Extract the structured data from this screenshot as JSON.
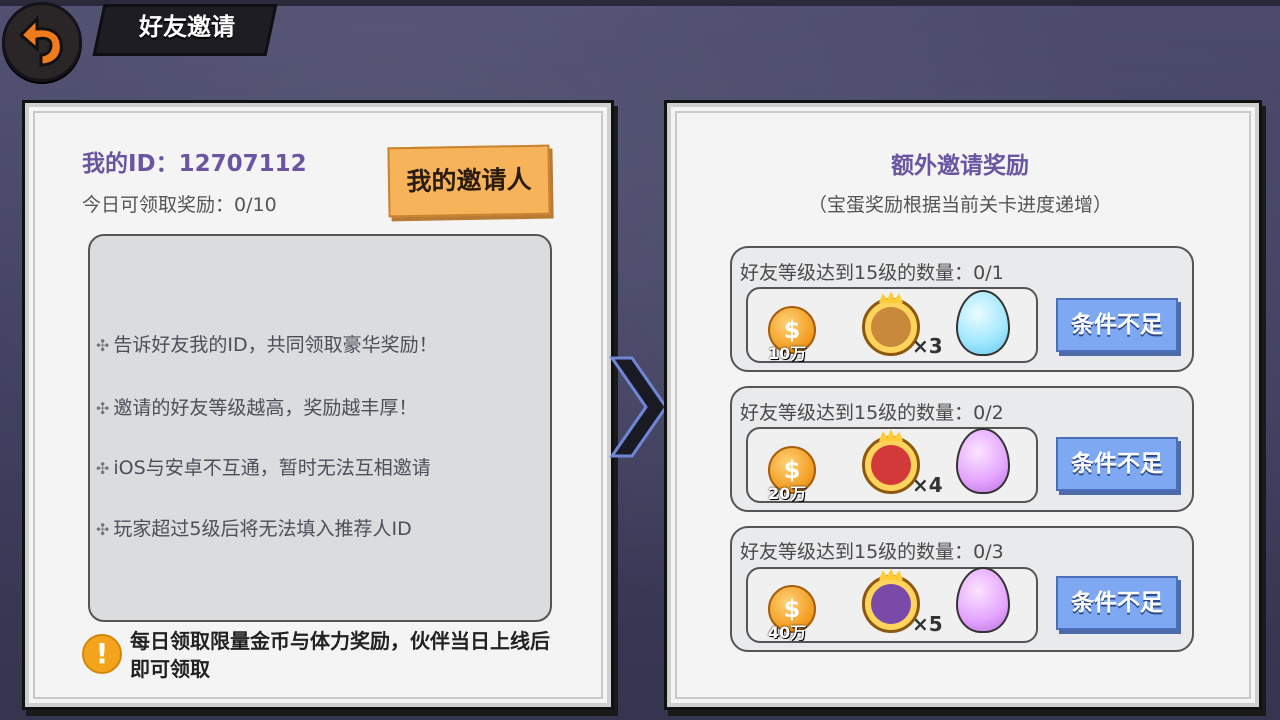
{
  "header": {
    "title": "好友邀请"
  },
  "left_panel": {
    "my_id": "我的ID：12707112",
    "today_reward": "今日可领取奖励：0/10",
    "inviter_button": "我的邀请人",
    "tips": [
      "告诉好友我的ID，共同领取豪华奖励！",
      "邀请的好友等级越高，奖励越丰厚！",
      "iOS与安卓不互通，暂时无法互相邀请",
      "玩家超过5级后将无法填入推荐人ID"
    ],
    "notice": "每日领取限量金币与体力奖励，伙伴当日上线后即可领取"
  },
  "right_panel": {
    "title": "额外邀请奖励",
    "subtitle": "（宝蛋奖励根据当前关卡进度递增）",
    "rewards": [
      {
        "label": "好友等级达到15级的数量：0/1",
        "coin_amount": "10万",
        "hero_qty": "×3",
        "egg": "ice",
        "button": "条件不足"
      },
      {
        "label": "好友等级达到15级的数量：0/2",
        "coin_amount": "20万",
        "hero_qty": "×4",
        "egg": "purple",
        "button": "条件不足"
      },
      {
        "label": "好友等级达到15级的数量：0/3",
        "coin_amount": "40万",
        "hero_qty": "×5",
        "egg": "purple",
        "button": "条件不足"
      }
    ]
  },
  "icons": {
    "back": "back-arrow-icon",
    "warning": "warning-icon",
    "coin_symbol": "$"
  }
}
